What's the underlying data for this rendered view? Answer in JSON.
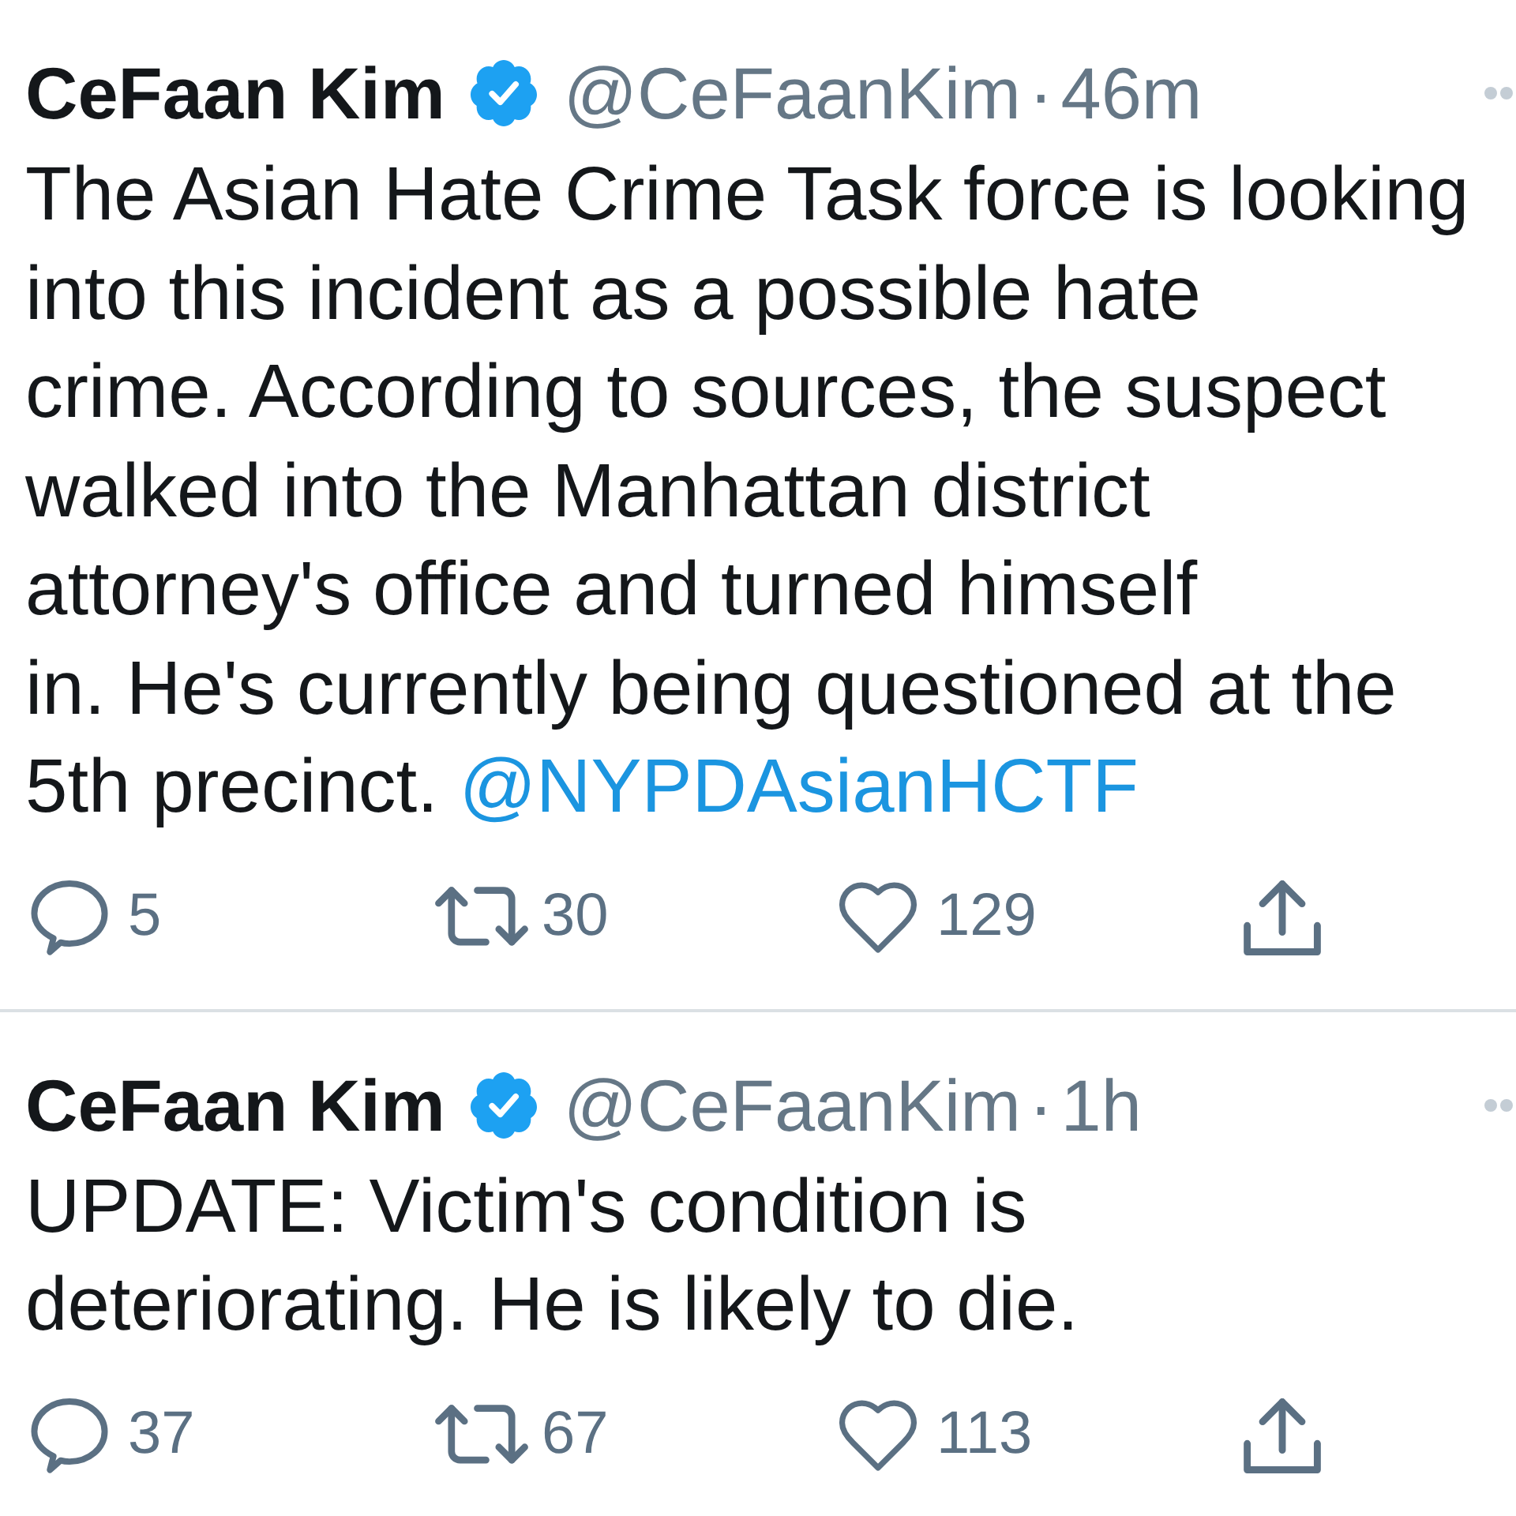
{
  "tweets": [
    {
      "name": "CeFaan Kim",
      "verified": true,
      "handle": "@CeFaanKim",
      "separator": "·",
      "time": "46m",
      "lines": [
        "The Asian Hate Crime Task force is looking",
        "into this incident as a possible hate",
        "crime. According to sources, the suspect",
        "walked into the Manhattan district",
        "attorney's office and turned himself",
        "in. He's currently being questioned at the",
        "5th precinct."
      ],
      "mention": "@NYPDAsianHCTF",
      "actions": [
        {
          "kind": "reply",
          "count": "5"
        },
        {
          "kind": "retweet",
          "count": "30"
        },
        {
          "kind": "like",
          "count": "129"
        },
        {
          "kind": "share"
        }
      ]
    },
    {
      "name": "CeFaan Kim",
      "verified": true,
      "handle": "@CeFaanKim",
      "separator": "·",
      "time": "1h",
      "lines": [
        "UPDATE: Victim's condition is",
        "deteriorating. He is likely to die."
      ],
      "actions": [
        {
          "kind": "reply",
          "count": "37"
        },
        {
          "kind": "retweet",
          "count": "67"
        },
        {
          "kind": "like",
          "count": "113"
        },
        {
          "kind": "share"
        }
      ]
    }
  ]
}
